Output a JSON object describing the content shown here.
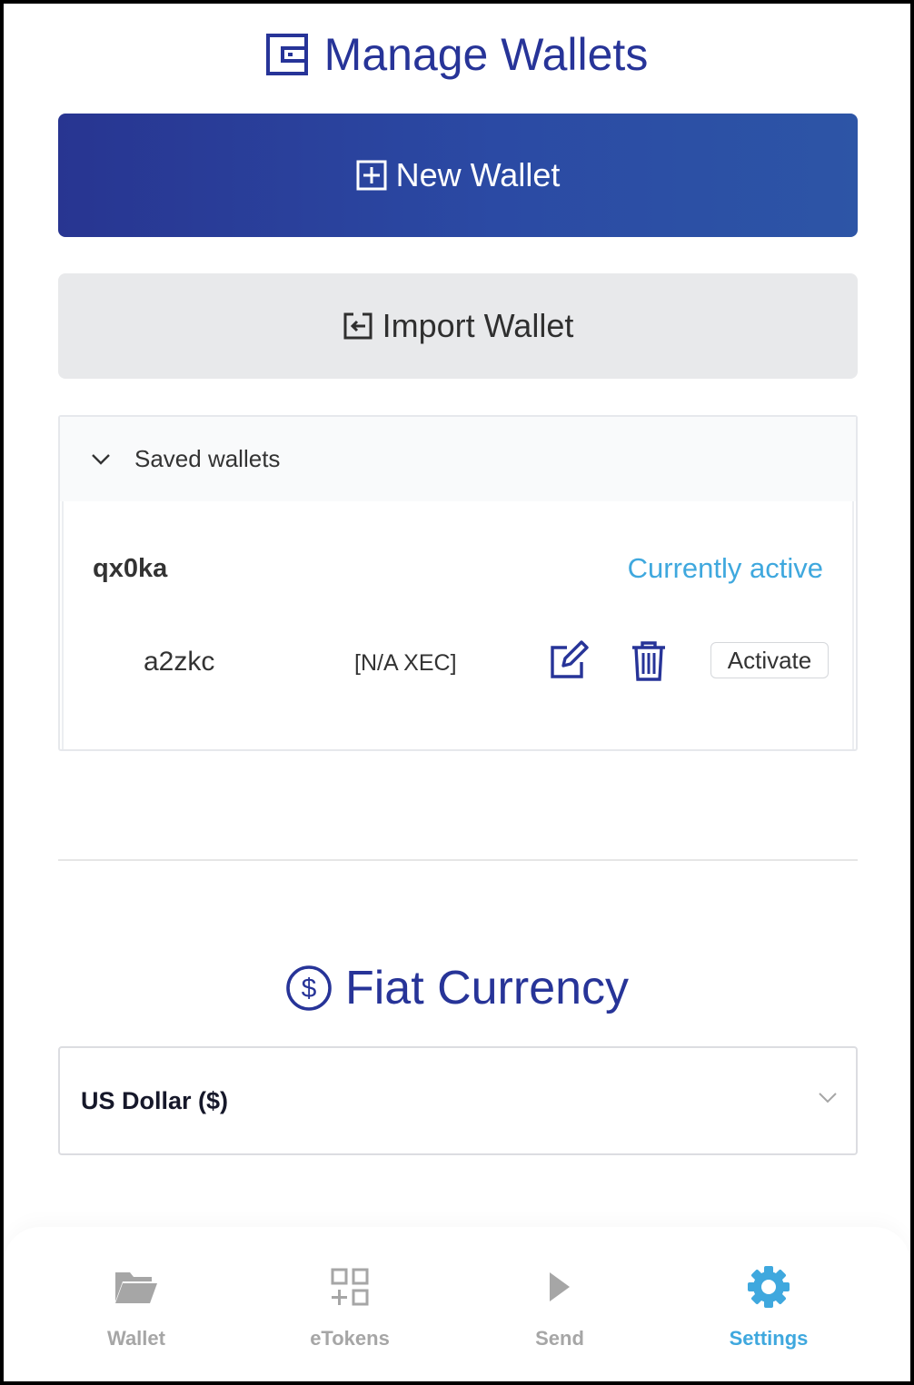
{
  "manage_wallets": {
    "title": "Manage Wallets",
    "new_wallet_label": "New Wallet",
    "import_wallet_label": "Import Wallet"
  },
  "saved_wallets": {
    "header": "Saved wallets",
    "active_wallet_name": "qx0ka",
    "active_status": "Currently active",
    "wallets": [
      {
        "name": "a2zkc",
        "balance": "[N/A XEC]",
        "activate_label": "Activate"
      }
    ]
  },
  "fiat_currency": {
    "title": "Fiat Currency",
    "selected": "US Dollar ($)"
  },
  "nav": {
    "items": [
      {
        "label": "Wallet",
        "icon": "folder-icon",
        "active": false
      },
      {
        "label": "eTokens",
        "icon": "tokens-grid-icon",
        "active": false
      },
      {
        "label": "Send",
        "icon": "send-play-icon",
        "active": false
      },
      {
        "label": "Settings",
        "icon": "gear-icon",
        "active": true
      }
    ]
  },
  "colors": {
    "brand": "#273498",
    "accent": "#3fa8de",
    "muted": "#a6a6a6"
  }
}
